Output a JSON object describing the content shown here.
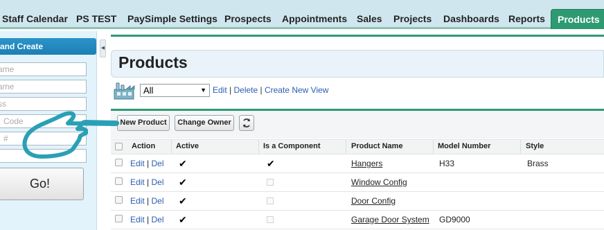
{
  "tabs": [
    {
      "label": "Staff Calendar",
      "active": false
    },
    {
      "label": "PS TEST",
      "active": false
    },
    {
      "label": "PaySimple Settings",
      "active": false
    },
    {
      "label": "Prospects",
      "active": false
    },
    {
      "label": "Appointments",
      "active": false
    },
    {
      "label": "Sales",
      "active": false
    },
    {
      "label": "Projects",
      "active": false
    },
    {
      "label": "Dashboards",
      "active": false
    },
    {
      "label": "Reports",
      "active": false
    },
    {
      "label": "Products",
      "active": true
    }
  ],
  "sidebar": {
    "header": "and Create",
    "fields": [
      "ame",
      "ame",
      "ss",
      "Code",
      "#",
      ""
    ],
    "go_label": "Go!"
  },
  "main": {
    "title": "Products",
    "view": {
      "selected": "All",
      "edit_label": "Edit",
      "delete_label": "Delete",
      "create_label": "Create New View"
    },
    "toolbar": {
      "new_product_label": "New Product",
      "change_owner_label": "Change Owner"
    },
    "columns": [
      "Action",
      "Active",
      "Is a Component",
      "Product Name",
      "Model Number",
      "Style"
    ],
    "rows": [
      {
        "edit": "Edit",
        "del": "Del",
        "active": true,
        "component": true,
        "name": "Hangers",
        "model": "H33",
        "style": "Brass"
      },
      {
        "edit": "Edit",
        "del": "Del",
        "active": true,
        "component": false,
        "name": "Window Config",
        "model": "",
        "style": ""
      },
      {
        "edit": "Edit",
        "del": "Del",
        "active": true,
        "component": false,
        "name": "Door Config",
        "model": "",
        "style": ""
      },
      {
        "edit": "Edit",
        "del": "Del",
        "active": true,
        "component": false,
        "name": "Garage Door System",
        "model": "GD9000",
        "style": ""
      }
    ]
  },
  "colors": {
    "accent_green": "#2e9a72",
    "sidebar_header_blue": "#1d7fb4",
    "link_blue": "#2a5db0",
    "annotation_teal": "#2aa0b6"
  },
  "icons": {
    "view_icon": "factory-icon",
    "refresh_icon": "refresh-icon",
    "collapse_icon": "chevron-left-icon",
    "annotation": "pointing-hand-icon"
  }
}
